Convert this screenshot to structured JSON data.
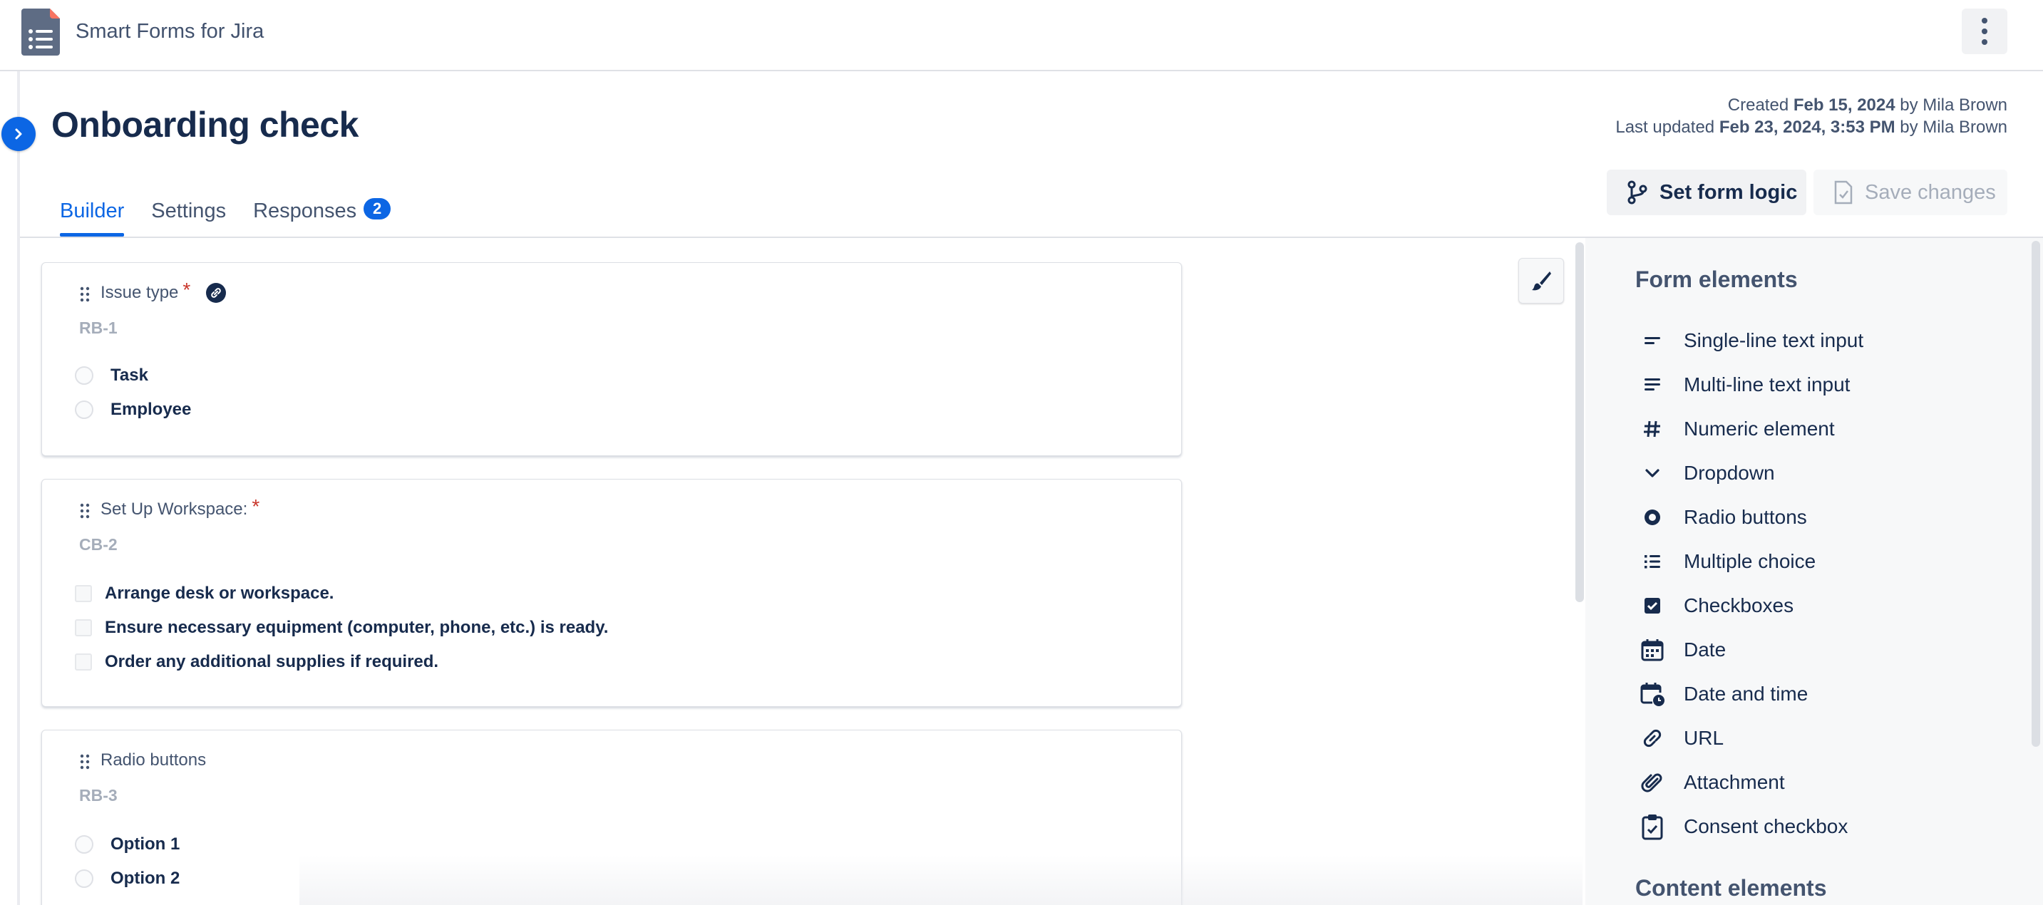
{
  "app": {
    "name": "Smart Forms for Jira"
  },
  "page": {
    "title": "Onboarding check",
    "created_prefix": "Created ",
    "created_date": "Feb 15, 2024",
    "created_suffix": " by Mila Brown",
    "updated_prefix": "Last updated ",
    "updated_date": "Feb 23, 2024, 3:53 PM",
    "updated_suffix": " by Mila Brown"
  },
  "tabs": [
    {
      "label": "Builder",
      "active": true
    },
    {
      "label": "Settings",
      "active": false
    },
    {
      "label": "Responses",
      "active": false,
      "badge": "2"
    }
  ],
  "toolbar": {
    "logic_label": "Set form logic",
    "save_label": "Save changes"
  },
  "cards": [
    {
      "title": "Issue type",
      "required": "*",
      "id": "RB-1",
      "kind": "radio",
      "options": [
        "Task",
        "Employee"
      ]
    },
    {
      "title": "Set Up Workspace:",
      "required": "*",
      "id": "CB-2",
      "kind": "checkbox",
      "options": [
        "Arrange desk or workspace.",
        "Ensure necessary equipment (computer, phone, etc.) is ready.",
        "Order any additional supplies if required."
      ]
    },
    {
      "title": "Radio buttons",
      "id": "RB-3",
      "kind": "radio",
      "options": [
        "Option 1",
        "Option 2"
      ]
    }
  ],
  "side": {
    "form_heading": "Form elements",
    "items": [
      {
        "label": "Single-line text input",
        "icon": "short-text-icon"
      },
      {
        "label": "Multi-line text input",
        "icon": "long-text-icon"
      },
      {
        "label": "Numeric element",
        "icon": "hash-icon"
      },
      {
        "label": "Dropdown",
        "icon": "chevron-down-icon"
      },
      {
        "label": "Radio buttons",
        "icon": "radio-icon"
      },
      {
        "label": "Multiple choice",
        "icon": "list-icon"
      },
      {
        "label": "Checkboxes",
        "icon": "checkbox-icon"
      },
      {
        "label": "Date",
        "icon": "calendar-icon"
      },
      {
        "label": "Date and time",
        "icon": "calendar-clock-icon"
      },
      {
        "label": "URL",
        "icon": "link-icon"
      },
      {
        "label": "Attachment",
        "icon": "paperclip-icon"
      },
      {
        "label": "Consent checkbox",
        "icon": "clipboard-check-icon"
      }
    ],
    "content_heading": "Content elements"
  },
  "colors": {
    "accent": "#0c66e4",
    "required": "#c9372c",
    "text": "#172b4d"
  }
}
